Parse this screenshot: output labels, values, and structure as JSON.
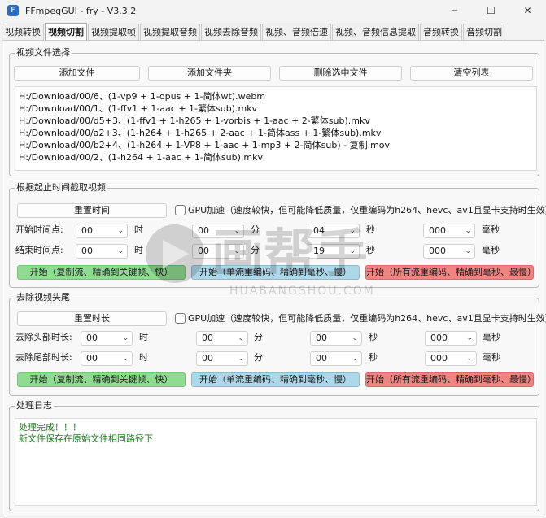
{
  "window": {
    "title": "FFmpegGUI - fry - V3.3.2",
    "icon": "app-icon",
    "minimize": "─",
    "maximize": "☐",
    "close": "✕"
  },
  "tabs": [
    {
      "label": "视频转换"
    },
    {
      "label": "视频切割"
    },
    {
      "label": "视频提取帧"
    },
    {
      "label": "视频提取音频"
    },
    {
      "label": "视频去除音频"
    },
    {
      "label": "视频、音频倍速"
    },
    {
      "label": "视频、音频信息提取"
    },
    {
      "label": "音频转换"
    },
    {
      "label": "音频切割"
    }
  ],
  "file_group": {
    "title": "视频文件选择",
    "add_file": "添加文件",
    "add_folder": "添加文件夹",
    "delete_selected": "删除选中文件",
    "clear_list": "清空列表",
    "files": [
      "H:/Download/00/6、(1-vp9 + 1-opus + 1-简体wt).webm",
      "H:/Download/00/1、(1-ffv1 + 1-aac + 1-繁体sub).mkv",
      "H:/Download/00/d5+3、(1-ffv1 + 1-h265 + 1-vorbis  + 1-aac + 2-繁体sub).mkv",
      "H:/Download/00/a2+3、(1-h264 + 1-h265 + 2-aac + 1-简体ass + 1-繁体sub).mkv",
      "H:/Download/00/b2+4、(1-h264 + 1-VP8 + 1-aac  + 1-mp3 + 2-简体sub) - 复制.mov",
      "H:/Download/00/2、(1-h264 + 1-aac + 1-简体sub).mkv"
    ]
  },
  "cut_group": {
    "title": "根据起止时间截取视频",
    "reset": "重置时间",
    "gpu_label": "GPU加速（速度较快，但可能降低质量，仅重编码为h264、hevc、av1且显卡支持时生效）",
    "start_label": "开始时间点:",
    "end_label": "结束时间点:",
    "start": {
      "h": "00",
      "m": "00",
      "s": "04",
      "ms": "000"
    },
    "end": {
      "h": "00",
      "m": "00",
      "s": "19",
      "ms": "000"
    },
    "unit_h": "时",
    "unit_m": "分",
    "unit_s": "秒",
    "unit_ms": "毫秒",
    "btn_copy": "开始（复制流、精确到关键帧、快）",
    "btn_single": "开始（单流重编码、精确到毫秒、慢）",
    "btn_all": "开始（所有流重编码、精确到毫秒、最慢）"
  },
  "trim_group": {
    "title": "去除视频头尾",
    "reset": "重置时长",
    "gpu_label": "GPU加速（速度较快，但可能降低质量，仅重编码为h264、hevc、av1且显卡支持时生效）",
    "head_label": "去除头部时长:",
    "tail_label": "去除尾部时长:",
    "head": {
      "h": "00",
      "m": "00",
      "s": "00",
      "ms": "000"
    },
    "tail": {
      "h": "00",
      "m": "00",
      "s": "00",
      "ms": "000"
    },
    "unit_h": "时",
    "unit_m": "分",
    "unit_s": "秒",
    "unit_ms": "毫秒",
    "btn_copy": "开始（复制流、精确到关键帧、快）",
    "btn_single": "开始（单流重编码、精确到毫秒、慢）",
    "btn_all": "开始（所有流重编码、精确到毫秒、最慢）"
  },
  "log_group": {
    "title": "处理日志",
    "lines": [
      "处理完成！！！",
      "新文件保存在原始文件相同路径下"
    ]
  },
  "watermark": {
    "text": "画帮手",
    "subtext": "HUABANGSHOU.COM"
  },
  "colors": {
    "green_btn": "#8fdb8f",
    "blue_btn": "#add8ea",
    "red_btn": "#f08480",
    "log_text": "#1f7a1f"
  }
}
